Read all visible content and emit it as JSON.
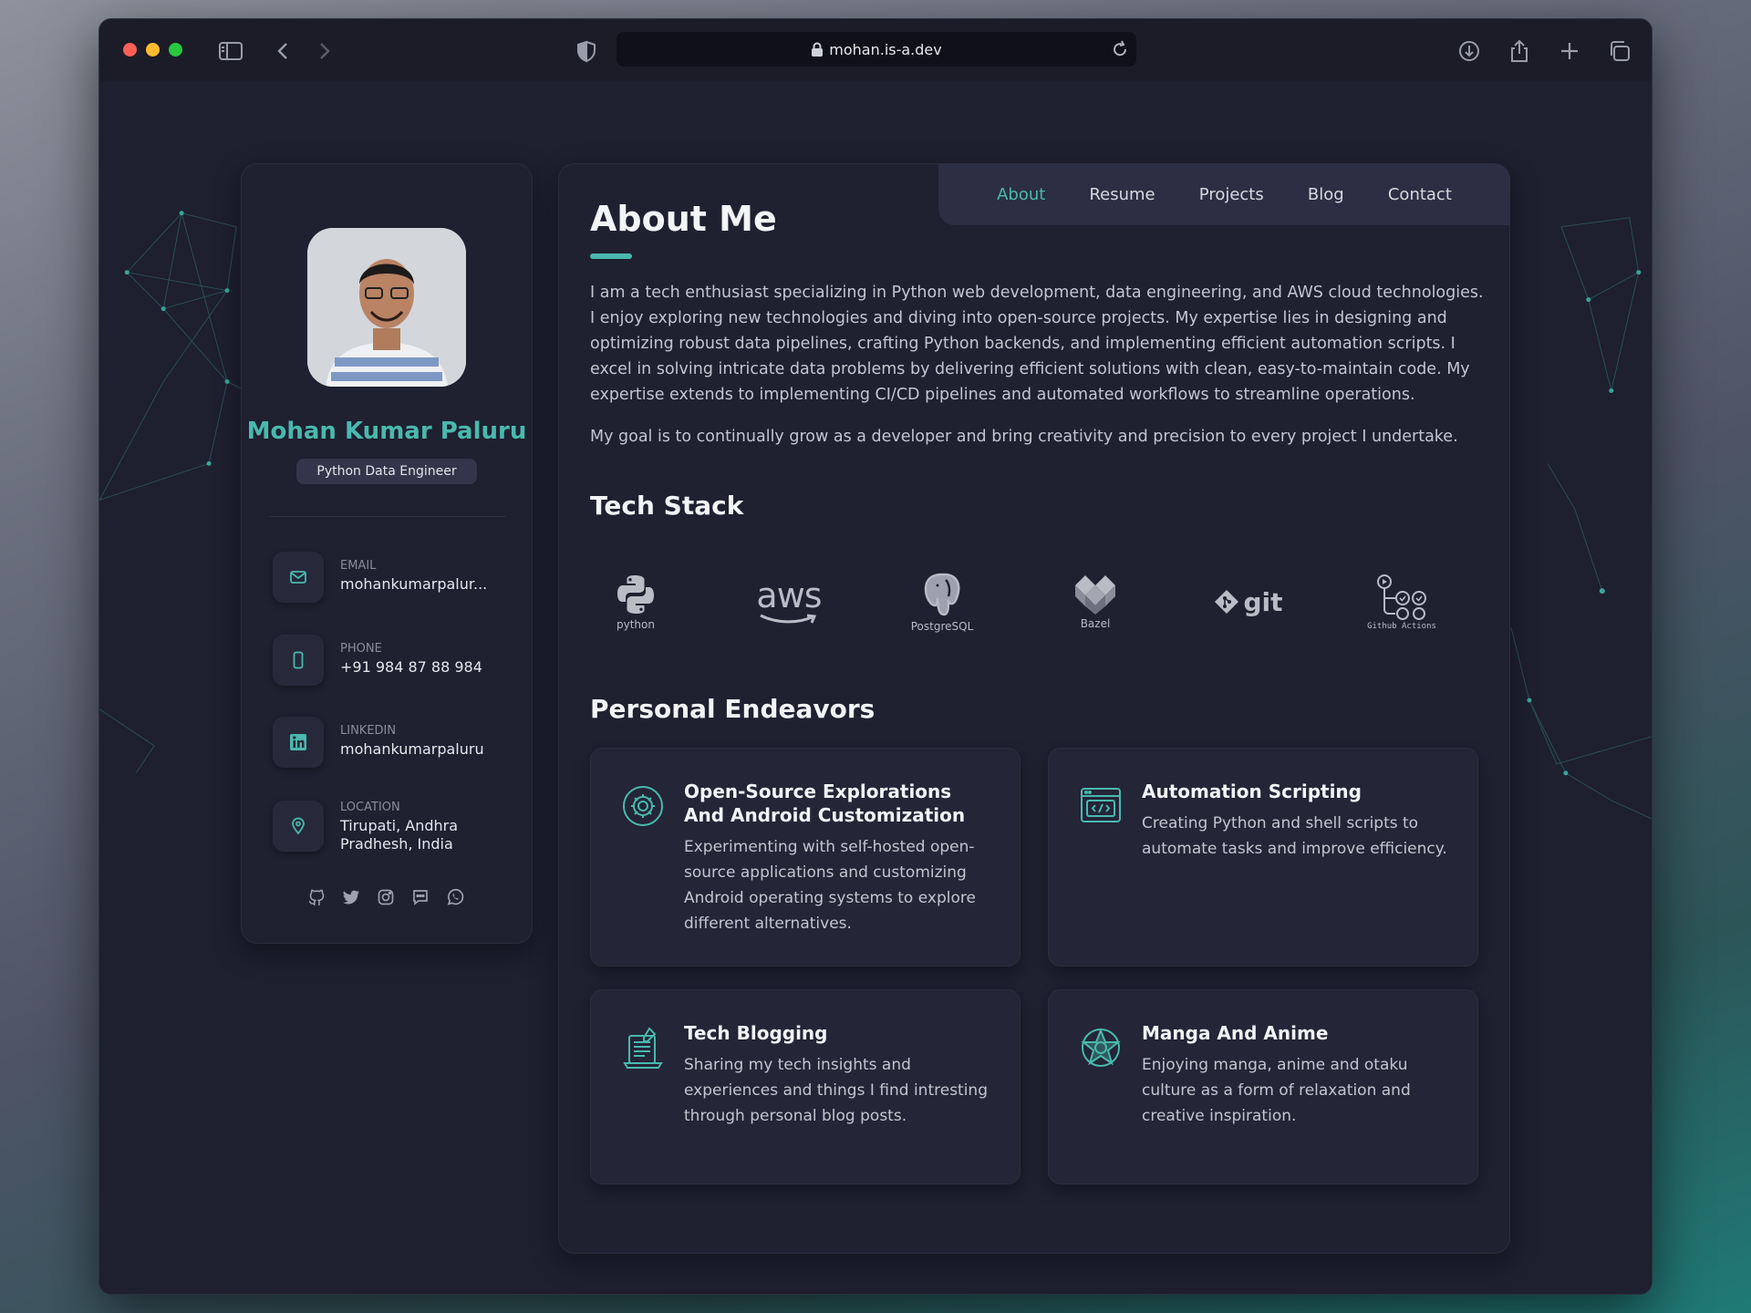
{
  "browser": {
    "url": "mohan.is-a.dev"
  },
  "profile": {
    "name": "Mohan Kumar Paluru",
    "role": "Python Data Engineer",
    "contacts": [
      {
        "label": "EMAIL",
        "value": "mohankumarpalur..."
      },
      {
        "label": "PHONE",
        "value": "+91 984 87 88 984"
      },
      {
        "label": "LINKEDIN",
        "value": "mohankumarpaluru"
      },
      {
        "label": "LOCATION",
        "value": "Tirupati, Andhra Pradhesh, India"
      }
    ],
    "socials": [
      "github-icon",
      "twitter-icon",
      "instagram-icon",
      "chat-icon",
      "whatsapp-icon"
    ]
  },
  "nav": {
    "items": [
      "About",
      "Resume",
      "Projects",
      "Blog",
      "Contact"
    ],
    "active": "About"
  },
  "about": {
    "title": "About Me",
    "paragraph1": "I am a tech enthusiast specializing in Python web development, data engineering, and AWS cloud technologies. I enjoy exploring new technologies and diving into open-source projects. My expertise lies in designing and optimizing robust data pipelines, crafting Python backends, and implementing efficient automation scripts. I excel in solving intricate data problems by delivering efficient solutions with clean, easy-to-maintain code. My expertise extends to implementing CI/CD pipelines and automated workflows to streamline operations.",
    "paragraph2": "My goal is to continually grow as a developer and bring creativity and precision to every project I undertake."
  },
  "tech_stack": {
    "title": "Tech Stack",
    "logos": [
      {
        "icon": "python-logo",
        "text": "python"
      },
      {
        "icon": "aws-logo",
        "text": "aws"
      },
      {
        "icon": "postgresql-logo",
        "text": "PostgreSQL"
      },
      {
        "icon": "bazel-logo",
        "text": "Bazel"
      },
      {
        "icon": "git-logo",
        "text": "git"
      },
      {
        "icon": "github-actions-logo",
        "text": "Github Actions"
      }
    ]
  },
  "endeavors": {
    "title": "Personal Endeavors",
    "cards": [
      {
        "icon": "gear-icon",
        "title": "Open-Source Explorations And Android Customization",
        "text": "Experimenting with self-hosted open-source applications and customizing Android operating systems to explore different alternatives."
      },
      {
        "icon": "code-window-icon",
        "title": "Automation Scripting",
        "text": "Creating Python and shell scripts to automate tasks and improve efficiency."
      },
      {
        "icon": "blog-icon",
        "title": "Tech Blogging",
        "text": "Sharing my tech insights and experiences and things I find intresting through personal blog posts."
      },
      {
        "icon": "star-emblem-icon",
        "title": "Manga And Anime",
        "text": "Enjoying manga, anime and otaku culture as a form of relaxation and creative inspiration."
      }
    ]
  },
  "colors": {
    "accent": "#49b9ad",
    "background": "#1e1f2f",
    "card": "#242537"
  }
}
